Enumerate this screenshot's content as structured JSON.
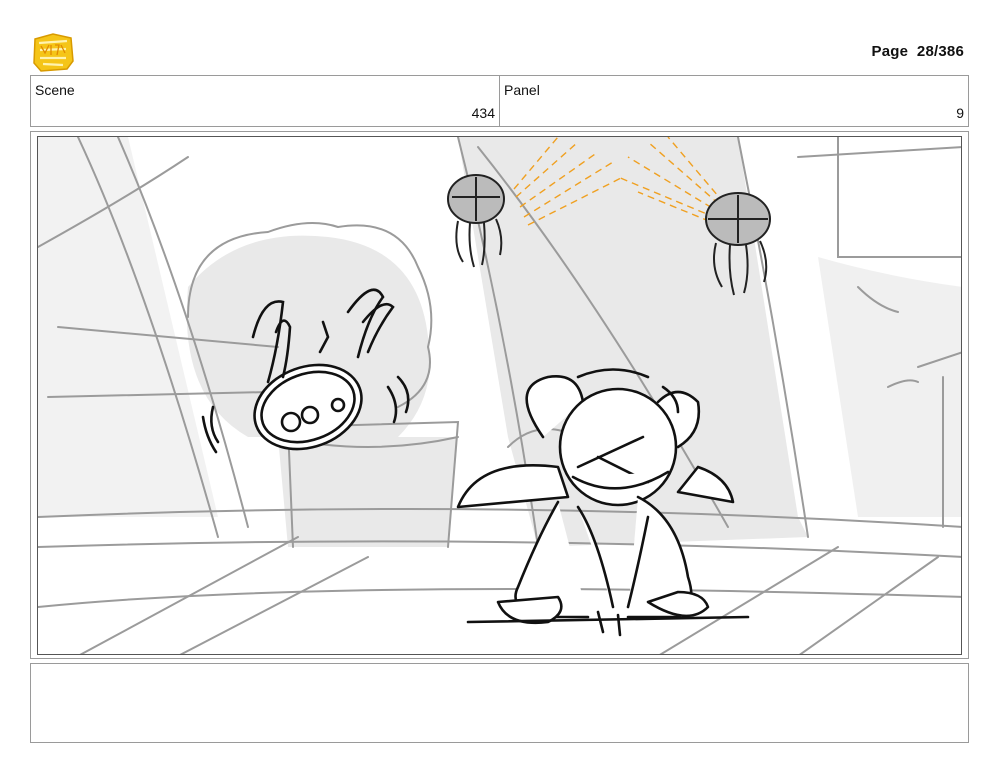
{
  "header": {
    "logo_icon": "show-logo-icon",
    "logo_colors": {
      "fill": "#f5c518",
      "stroke": "#d89a00"
    },
    "page_label": "Page",
    "page_number": "28/386"
  },
  "info": {
    "scene_label": "Scene",
    "scene_value": "434",
    "panel_label": "Panel",
    "panel_value": "9"
  },
  "drawing": {
    "colors": {
      "sketch": "#111111",
      "background_lines": "#9b9b9b",
      "light_beams": "#f0a020",
      "fill": "#e6e6e6"
    }
  },
  "notes": {
    "text": ""
  }
}
